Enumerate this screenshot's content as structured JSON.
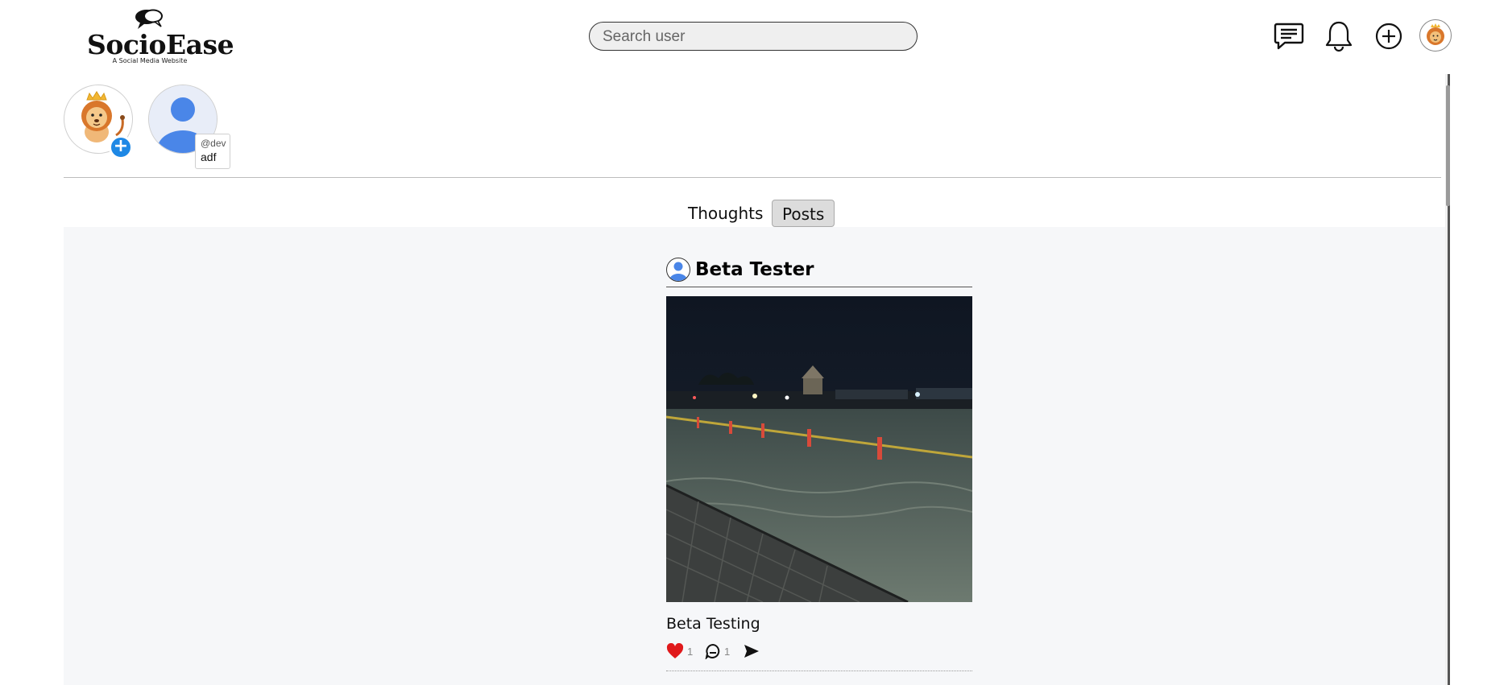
{
  "brand": {
    "name": "SocioEase",
    "tagline": "A Social Media Website"
  },
  "search": {
    "placeholder": "Search user"
  },
  "stories": {
    "user_handle": "@dev",
    "user_name": "adf"
  },
  "tabs": [
    {
      "label": "Thoughts",
      "active": false
    },
    {
      "label": "Posts",
      "active": true
    }
  ],
  "post": {
    "author": "Beta Tester",
    "caption": "Beta Testing",
    "likes": "1",
    "comments": "1"
  },
  "colors": {
    "accent": "#1e88e5",
    "like": "#e0191b",
    "feed_bg": "#f6f7f9"
  },
  "icons": [
    "chat-icon",
    "bell-icon",
    "plus-circle-icon",
    "lion-avatar",
    "add-story-icon",
    "heart-icon",
    "comment-icon",
    "send-icon"
  ]
}
